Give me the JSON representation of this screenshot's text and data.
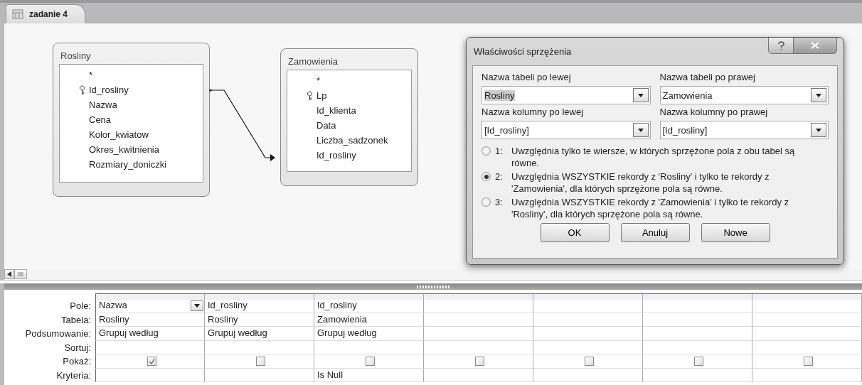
{
  "tab": {
    "title": "zadanie 4"
  },
  "tables": [
    {
      "title": "Rosliny",
      "fields": [
        {
          "name": "*",
          "primary_key": false
        },
        {
          "name": "Id_rosliny",
          "primary_key": true
        },
        {
          "name": "Nazwa",
          "primary_key": false
        },
        {
          "name": "Cena",
          "primary_key": false
        },
        {
          "name": "Kolor_kwiatow",
          "primary_key": false
        },
        {
          "name": "Okres_kwitnienia",
          "primary_key": false
        },
        {
          "name": "Rozmiary_doniczki",
          "primary_key": false
        }
      ]
    },
    {
      "title": "Zamowienia",
      "fields": [
        {
          "name": "*",
          "primary_key": false
        },
        {
          "name": "Lp",
          "primary_key": true
        },
        {
          "name": "Id_klienta",
          "primary_key": false
        },
        {
          "name": "Data",
          "primary_key": false
        },
        {
          "name": "Liczba_sadzonek",
          "primary_key": false
        },
        {
          "name": "Id_rosliny",
          "primary_key": false
        }
      ]
    }
  ],
  "dialog": {
    "title": "Właściwości sprzężenia",
    "fields": [
      {
        "label": "Nazwa tabeli po lewej",
        "value": "Rosliny",
        "highlighted": true
      },
      {
        "label": "Nazwa tabeli po prawej",
        "value": "Zamowienia",
        "highlighted": false
      },
      {
        "label": "Nazwa kolumny po lewej",
        "value": "[Id_rosliny]",
        "highlighted": false
      },
      {
        "label": "Nazwa kolumny po prawej",
        "value": "[Id_rosliny]",
        "highlighted": false
      }
    ],
    "options": [
      {
        "number": "1:",
        "text": "Uwzględnia tylko te wiersze, w których sprzężone pola z obu tabel są równe.",
        "selected": false
      },
      {
        "number": "2:",
        "text": "Uwzględnia WSZYSTKIE rekordy z 'Rosliny' i tylko te rekordy z 'Zamowienia', dla których sprzężone pola są równe.",
        "selected": true
      },
      {
        "number": "3:",
        "text": "Uwzględnia WSZYSTKIE rekordy z 'Zamowienia' i tylko te rekordy z 'Rosliny', dla których sprzężone pola są równe.",
        "selected": false
      }
    ],
    "buttons": [
      "OK",
      "Anuluj",
      "Nowe"
    ]
  },
  "grid": {
    "row_labels": [
      "Pole:",
      "Tabela:",
      "Podsumowanie:",
      "Sortuj:",
      "Pokaż:",
      "Kryteria:"
    ],
    "columns": [
      {
        "pole": "Nazwa",
        "tabela": "Rosliny",
        "podsumowanie": "Grupuj według",
        "show": true,
        "focused": true
      },
      {
        "pole": "Id_rosliny",
        "tabela": "Rosliny",
        "podsumowanie": "Grupuj według",
        "show": false,
        "focused": false
      },
      {
        "pole": "Id_rosliny",
        "tabela": "Zamowienia",
        "podsumowanie": "Grupuj według",
        "show": false,
        "kryteria": "Is Null",
        "focused": false
      },
      {
        "show": false,
        "focused": false
      },
      {
        "show": false,
        "focused": false
      },
      {
        "show": false,
        "focused": false
      },
      {
        "show": false,
        "focused": false
      }
    ]
  }
}
